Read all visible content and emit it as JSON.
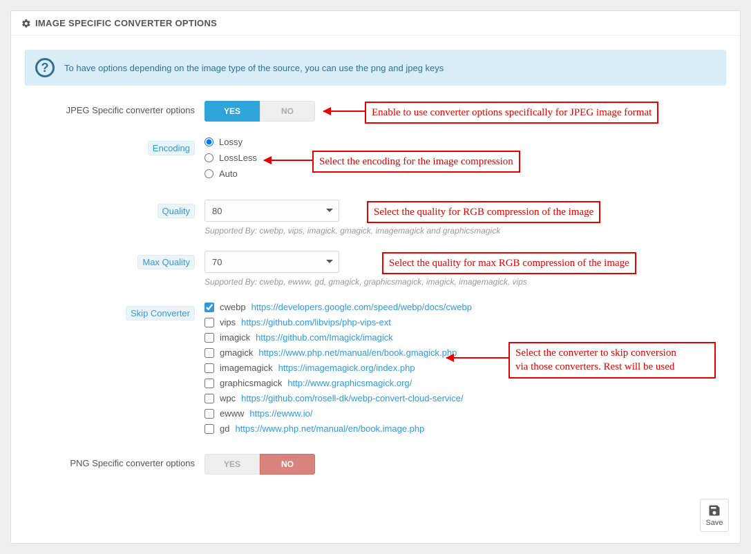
{
  "panel": {
    "title": "IMAGE SPECIFIC CONVERTER OPTIONS"
  },
  "info_bar": {
    "text": "To have options depending on the image type of the source, you can use the png and jpeg keys"
  },
  "jpeg": {
    "label": "JPEG Specific converter options",
    "yes": "YES",
    "no": "NO",
    "enabled": true
  },
  "encoding": {
    "label": "Encoding",
    "options": [
      "Lossy",
      "LossLess",
      "Auto"
    ],
    "selected_index": 0
  },
  "quality": {
    "label": "Quality",
    "value": "80",
    "help": "Supported By: cwebp, vips, imagick, gmagick, imagemagick and graphicsmagick"
  },
  "max_quality": {
    "label": "Max Quality",
    "value": "70",
    "help": "Supported By: cwebp, ewww, gd, gmagick, graphicsmagick, imagick, imagemagick, vips"
  },
  "skip": {
    "label": "Skip Converter",
    "items": [
      {
        "checked": true,
        "name": "cwebp",
        "url": "https://developers.google.com/speed/webp/docs/cwebp"
      },
      {
        "checked": false,
        "name": "vips",
        "url": "https://github.com/libvips/php-vips-ext"
      },
      {
        "checked": false,
        "name": "imagick",
        "url": "https://github.com/Imagick/imagick"
      },
      {
        "checked": false,
        "name": "gmagick",
        "url": "https://www.php.net/manual/en/book.gmagick.php"
      },
      {
        "checked": false,
        "name": "imagemagick",
        "url": "https://imagemagick.org/index.php"
      },
      {
        "checked": false,
        "name": "graphicsmagick",
        "url": "http://www.graphicsmagick.org/"
      },
      {
        "checked": false,
        "name": "wpc",
        "url": "https://github.com/rosell-dk/webp-convert-cloud-service/"
      },
      {
        "checked": false,
        "name": "ewww",
        "url": "https://ewww.io/"
      },
      {
        "checked": false,
        "name": "gd",
        "url": "https://www.php.net/manual/en/book.image.php"
      }
    ]
  },
  "png": {
    "label": "PNG Specific converter options",
    "yes": "YES",
    "no": "NO",
    "enabled": false
  },
  "save": {
    "label": "Save"
  },
  "annotations": {
    "jpeg_toggle": "Enable to use converter options specifically for JPEG image format",
    "encoding": "Select the encoding for the image compression",
    "quality": "Select the quality for RGB compression of the image",
    "max_quality": "Select the quality for max RGB compression of the image",
    "skip_line1": "Select the converter to skip conversion",
    "skip_line2": "via those converters. Rest will be used"
  }
}
